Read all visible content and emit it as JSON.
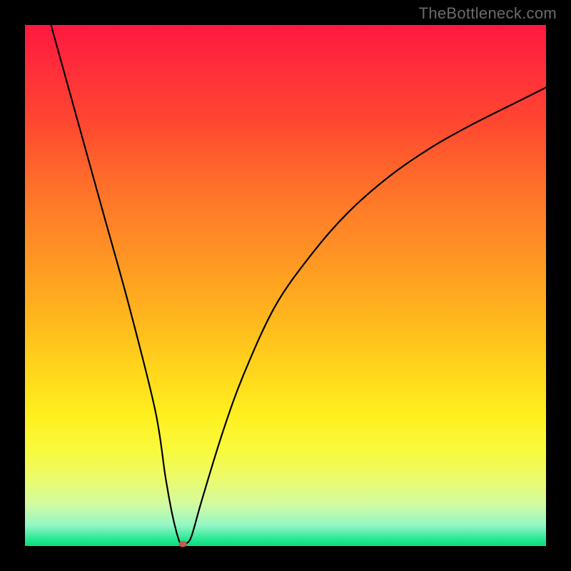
{
  "watermark": "TheBottleneck.com",
  "chart_data": {
    "type": "line",
    "title": "",
    "xlabel": "",
    "ylabel": "",
    "xlim": [
      0,
      100
    ],
    "ylim": [
      0,
      100
    ],
    "series": [
      {
        "name": "curve",
        "x": [
          5,
          10,
          15,
          20,
          25,
          27,
          28.5,
          30,
          31,
          32,
          34,
          38,
          42,
          48,
          55,
          62,
          70,
          78,
          86,
          95,
          100
        ],
        "values": [
          100,
          82,
          64,
          46,
          26,
          13,
          5,
          0,
          0.5,
          2,
          9,
          22,
          33,
          46,
          56,
          64,
          71,
          76.5,
          81,
          85.5,
          88
        ]
      }
    ],
    "marker": {
      "x": 30.3,
      "y": 0.4,
      "rx": 5.5,
      "ry": 4.5
    }
  },
  "icons": {
    "curve": "bottleneck-curve"
  }
}
